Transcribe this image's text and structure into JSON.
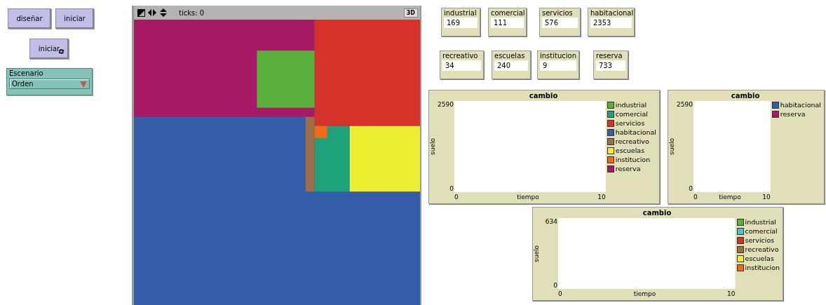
{
  "buttons": [
    {
      "label": "diseñar",
      "kind": "once"
    },
    {
      "label": "iniciar",
      "kind": "once"
    },
    {
      "label": "iniciar",
      "kind": "forever"
    }
  ],
  "chooser": {
    "label": "Escenario",
    "value": "Orden"
  },
  "view": {
    "ticks": "ticks: 0",
    "button_3d": "3D"
  },
  "monitors": [
    {
      "label": "industrial",
      "value": "169"
    },
    {
      "label": "comercial",
      "value": "111"
    },
    {
      "label": "servicios",
      "value": "576"
    },
    {
      "label": "habitacional",
      "value": "2353"
    },
    {
      "label": "recreativo",
      "value": "34"
    },
    {
      "label": "escuelas",
      "value": "240"
    },
    {
      "label": "institucion",
      "value": "9"
    },
    {
      "label": "reserva",
      "value": "733"
    }
  ],
  "plots": [
    {
      "title": "cambio",
      "ylabel": "suelo",
      "xlabel": "tiempo",
      "y_max": "2590",
      "y_min": "0",
      "x_min": "0",
      "x_max": "10",
      "legend": [
        {
          "name": "industrial",
          "color": "#59b03c"
        },
        {
          "name": "comercial",
          "color": "#1da27c"
        },
        {
          "name": "servicios",
          "color": "#d73229"
        },
        {
          "name": "habitacional",
          "color": "#345da9"
        },
        {
          "name": "recreativo",
          "color": "#9d6e48"
        },
        {
          "name": "escuelas",
          "color": "#eded31"
        },
        {
          "name": "institucion",
          "color": "#f16a15"
        },
        {
          "name": "reserva",
          "color": "#a71a66"
        }
      ]
    },
    {
      "title": "cambio",
      "ylabel": "suelo",
      "xlabel": "tiempo",
      "y_max": "2590",
      "y_min": "0",
      "x_min": "0",
      "x_max": "10",
      "legend": [
        {
          "name": "habitacional",
          "color": "#345da9"
        },
        {
          "name": "reserva",
          "color": "#a71a66"
        }
      ]
    },
    {
      "title": "cambio",
      "ylabel": "suelo",
      "xlabel": "tiempo",
      "y_max": "634",
      "y_min": "0",
      "x_min": "0",
      "x_max": "10",
      "legend": [
        {
          "name": "industrial",
          "color": "#59b03c"
        },
        {
          "name": "comercial",
          "color": "#4ec2c9"
        },
        {
          "name": "servicios",
          "color": "#d73229"
        },
        {
          "name": "recreativo",
          "color": "#9d6e48"
        },
        {
          "name": "escuelas",
          "color": "#eded31"
        },
        {
          "name": "institucion",
          "color": "#f16a15"
        }
      ]
    }
  ]
}
